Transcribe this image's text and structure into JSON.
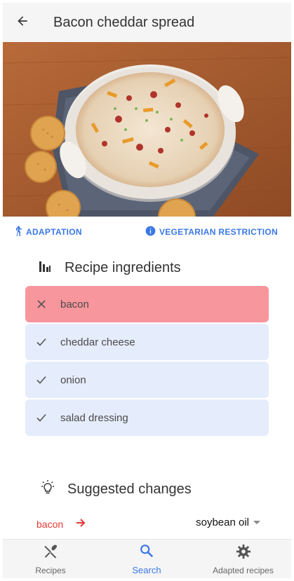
{
  "header": {
    "title": "Bacon cheddar spread"
  },
  "tags": {
    "adaptation": "ADAPTATION",
    "restriction": "VEGETARIAN RESTRICTION"
  },
  "ingredients_section": {
    "title": "Recipe ingredients",
    "items": [
      {
        "label": "bacon",
        "status": "removed"
      },
      {
        "label": "cheddar cheese",
        "status": "kept"
      },
      {
        "label": "onion",
        "status": "kept"
      },
      {
        "label": "salad dressing",
        "status": "kept"
      }
    ]
  },
  "suggested_section": {
    "title": "Suggested changes",
    "changes": [
      {
        "from": "bacon",
        "to": "soybean oil"
      }
    ]
  },
  "bottom_nav": {
    "items": [
      {
        "label": "Recipes",
        "icon": "fork-knife-icon",
        "active": false
      },
      {
        "label": "Search",
        "icon": "search-icon",
        "active": true
      },
      {
        "label": "Adapted recipes",
        "icon": "gear-icon",
        "active": false
      }
    ]
  },
  "colors": {
    "accent": "#3b78e7",
    "removed_bg": "#f7969c",
    "kept_bg": "#e5ecfb",
    "from_text": "#e53935"
  }
}
